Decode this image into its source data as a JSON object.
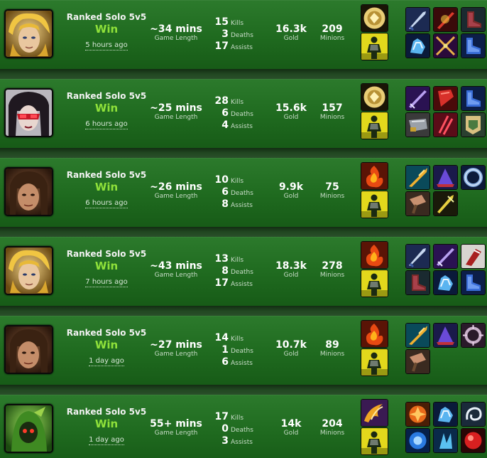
{
  "labels": {
    "game_length": "Game Length",
    "kills": "Kills",
    "deaths": "Deaths",
    "assists": "Assists",
    "gold": "Gold",
    "minions": "Minions"
  },
  "matches": [
    {
      "champion_icon": "blonde-champion-portrait-icon",
      "queue": "Ranked Solo 5v5",
      "result": "Win",
      "time_ago": "5 hours ago",
      "length": "~34 mins",
      "kills": "15",
      "deaths": "3",
      "assists": "17",
      "gold": "16.3k",
      "minions": "209",
      "spells": [
        "clarity-spell-icon",
        "ghost-spell-icon"
      ],
      "items": [
        "blade-item-icon",
        "infinity-edge-item-icon",
        "berserker-greaves-item-icon",
        "spirit-gauntlet-item-icon",
        "sword-item-icon",
        "blue-boots-item-icon"
      ]
    },
    {
      "champion_icon": "masked-champion-portrait-icon",
      "queue": "Ranked Solo 5v5",
      "result": "Win",
      "time_ago": "6 hours ago",
      "length": "~25 mins",
      "kills": "28",
      "deaths": "6",
      "assists": "4",
      "gold": "15.6k",
      "minions": "157",
      "spells": [
        "clarity-spell-icon",
        "ghost-spell-icon"
      ],
      "items": [
        "purple-blade-item-icon",
        "red-cleaver-item-icon",
        "blue-boots-item-icon",
        "armor-item-icon",
        "red-claw-item-icon",
        "banner-item-icon"
      ]
    },
    {
      "champion_icon": "dark-haired-champion-portrait-icon",
      "queue": "Ranked Solo 5v5",
      "result": "Win",
      "time_ago": "6 hours ago",
      "length": "~26 mins",
      "kills": "10",
      "deaths": "6",
      "assists": "8",
      "gold": "9.9k",
      "minions": "75",
      "spells": [
        "ignite-spell-icon",
        "ghost-spell-icon"
      ],
      "items": [
        "gold-spear-item-icon",
        "red-hat-item-icon",
        "ring-item-icon",
        "hammer-item-icon",
        "gold-blade-item-icon"
      ]
    },
    {
      "champion_icon": "blonde-champion-portrait-icon",
      "queue": "Ranked Solo 5v5",
      "result": "Win",
      "time_ago": "7 hours ago",
      "length": "~43 mins",
      "kills": "13",
      "deaths": "8",
      "assists": "17",
      "gold": "18.3k",
      "minions": "278",
      "spells": [
        "ignite-spell-icon",
        "ghost-spell-icon"
      ],
      "items": [
        "blade-item-icon",
        "purple-blade-item-icon",
        "bloody-axe-item-icon",
        "berserker-greaves-item-icon",
        "spirit-gauntlet-item-icon",
        "blue-boots-item-icon"
      ]
    },
    {
      "champion_icon": "dark-haired-champion-portrait-icon",
      "queue": "Ranked Solo 5v5",
      "result": "Win",
      "time_ago": "1 day ago",
      "length": "~27 mins",
      "kills": "14",
      "deaths": "1",
      "assists": "6",
      "gold": "10.7k",
      "minions": "89",
      "spells": [
        "ignite-spell-icon",
        "ghost-spell-icon"
      ],
      "items": [
        "gold-spear-item-icon",
        "red-hat-item-icon",
        "spiked-ring-item-icon",
        "hammer-item-icon"
      ]
    },
    {
      "champion_icon": "green-hooded-champion-portrait-icon",
      "queue": "Ranked Solo 5v5",
      "result": "Win",
      "time_ago": "1 day ago",
      "length": "55+ mins",
      "kills": "17",
      "deaths": "0",
      "assists": "3",
      "gold": "14k",
      "minions": "204",
      "spells": [
        "teleport-spell-icon",
        "ghost-spell-icon"
      ],
      "items": [
        "orange-crest-item-icon",
        "spirit-gauntlet-item-icon",
        "swirl-item-icon",
        "blue-crest-item-icon",
        "blue-claw-item-icon",
        "red-orb-item-icon"
      ]
    }
  ],
  "colors": {
    "win": "#8fe13a",
    "row_top": "#2c7a2c",
    "row_bottom": "#175b17"
  }
}
